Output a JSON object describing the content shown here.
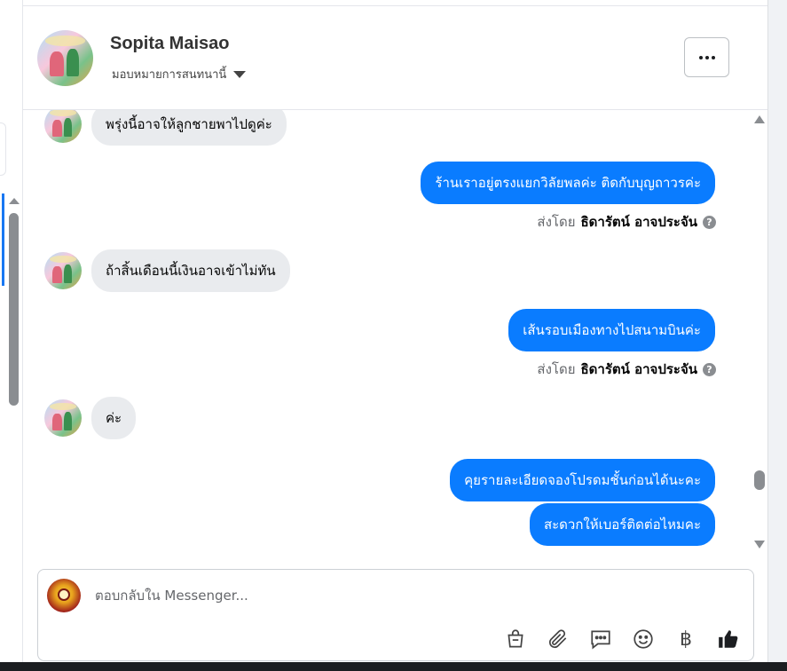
{
  "header": {
    "contact_name": "Sopita Maisao",
    "assign_label": "มอบหมายการสนทนานี้"
  },
  "messages": [
    {
      "direction": "in",
      "text": "พรุ่งนี้อาจให้ลูกชายพาไปดูค่ะ"
    },
    {
      "direction": "out",
      "text": "ร้านเราอยู่ตรงแยกวิลัยพลค่ะ ติดกับบุญถาวรค่ะ"
    },
    {
      "direction": "meta",
      "prefix": "ส่งโดย",
      "agent": "ธิดารัตน์ อาจประจัน"
    },
    {
      "direction": "in",
      "text": "ถ้าสิ้นเดือนนี้เงินอาจเข้าไม่ทัน"
    },
    {
      "direction": "out",
      "text": "เส้นรอบเมืองทางไปสนามบินค่ะ"
    },
    {
      "direction": "meta",
      "prefix": "ส่งโดย",
      "agent": "ธิดารัตน์ อาจประจัน"
    },
    {
      "direction": "in",
      "text": "ค่ะ"
    },
    {
      "direction": "out",
      "text": "คุยรายละเอียดจองโปรดมชั้นก่อนได้นะคะ"
    },
    {
      "direction": "out",
      "text": "สะดวกให้เบอร์ติดต่อไหมคะ"
    }
  ],
  "composer": {
    "placeholder": "ตอบกลับใน Messenger...",
    "tool_icons": [
      "shopping-bag-icon",
      "paperclip-icon",
      "saved-reply-icon",
      "emoji-icon",
      "baht-payment-icon",
      "thumbs-up-icon"
    ],
    "baht_symbol": "฿"
  },
  "colors": {
    "outgoing_bubble": "#0a7cff",
    "incoming_bubble": "#e9ebee",
    "accent": "#1877f2"
  }
}
